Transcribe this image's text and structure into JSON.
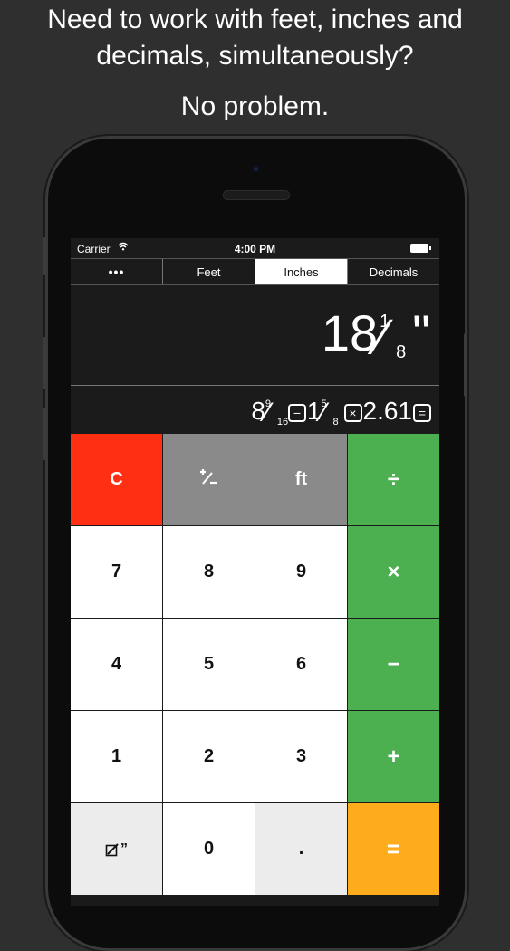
{
  "promo": {
    "headline": "Need to work with feet, inches and decimals, simultaneously?",
    "subline": "No problem."
  },
  "status_bar": {
    "carrier": "Carrier",
    "time": "4:00 PM"
  },
  "tabs": {
    "menu_label": "•••",
    "items": [
      "Feet",
      "Inches",
      "Decimals"
    ],
    "active": "Inches"
  },
  "display": {
    "whole": "18",
    "frac_num": "1",
    "frac_den": "8",
    "unit": "ʺ"
  },
  "expression": {
    "a_whole": "8",
    "a_num": "9",
    "a_den": "16",
    "op1": "−",
    "b_whole": "1",
    "b_num": "5",
    "b_den": "8",
    "op2": "×",
    "c_value": "2.61",
    "op3": "="
  },
  "keys": {
    "clear": "C",
    "sign": "+/-",
    "feet": "ft",
    "divide": "÷",
    "seven": "7",
    "eight": "8",
    "nine": "9",
    "multiply": "×",
    "four": "4",
    "five": "5",
    "six": "6",
    "minus": "−",
    "one": "1",
    "two": "2",
    "three": "3",
    "plus": "+",
    "inch_marker": "”",
    "zero": "0",
    "decimal": ".",
    "equals": "="
  },
  "colors": {
    "background": "#2f2f2f",
    "clear_key": "#ff2f13",
    "function_key": "#8a8a8a",
    "operator_key": "#4caf50",
    "equals_key": "#ffac1c"
  },
  "icons": {
    "wifi": "wifi-icon",
    "battery": "battery-icon",
    "inch_entry": "inch-entry-icon"
  }
}
